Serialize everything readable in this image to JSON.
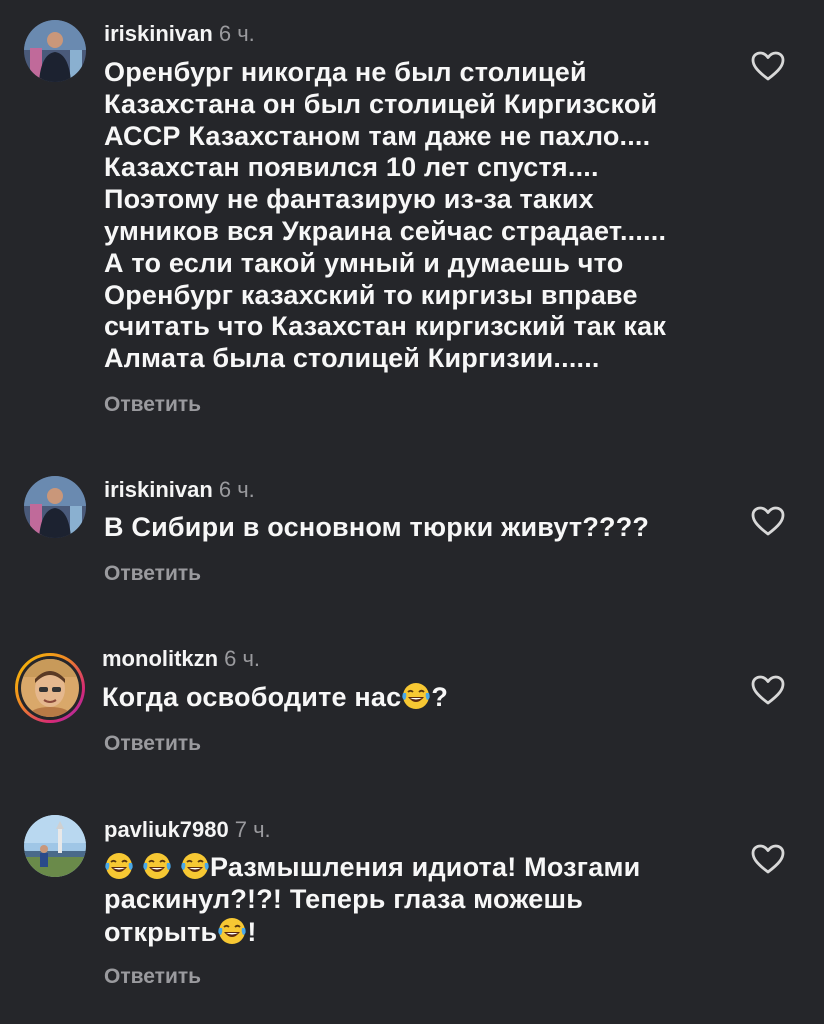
{
  "comments": [
    {
      "username": "iriskinivan",
      "time": "6 ч.",
      "lines": [
        "Оренбург никогда не был столицей",
        "Казахстана он был столицей Киргизской",
        "АССР Казахстаном там даже не пахло....",
        "Казахстан появился 10 лет спустя....",
        "Поэтому не фантазирую из-за таких",
        "умников вся Украина сейчас страдает......",
        "А то если такой умный и думаешь что",
        "Оренбург казахский то киргизы вправе",
        "считать что Казахстан киргизский так как",
        "Алмата была столицей Киргизии......"
      ],
      "reply_label": "Ответить"
    },
    {
      "username": "iriskinivan",
      "time": "6 ч.",
      "text": "В Сибири в основном тюрки живут????",
      "reply_label": "Ответить"
    },
    {
      "username": "monolitkzn",
      "time": "6 ч.",
      "text_before_emoji": "Когда освободите нас",
      "text_after_emoji": "?",
      "reply_label": "Ответить"
    },
    {
      "username": "pavliuk7980",
      "time": "7 ч.",
      "line1_text": "Размышления идиота! Мозгами",
      "line2_text": "раскинул?!?! Теперь глаза можешь",
      "line3_text_before_emoji": "открыть",
      "line3_text_after_emoji": "!",
      "reply_label": "Ответить"
    }
  ],
  "icons": {
    "like": "heart-outline-icon",
    "emoji": "face-with-tears-of-joy-emoji"
  },
  "colors": {
    "background": "#25262a",
    "text": "#f5f5f5",
    "muted": "#9a9a9e"
  }
}
